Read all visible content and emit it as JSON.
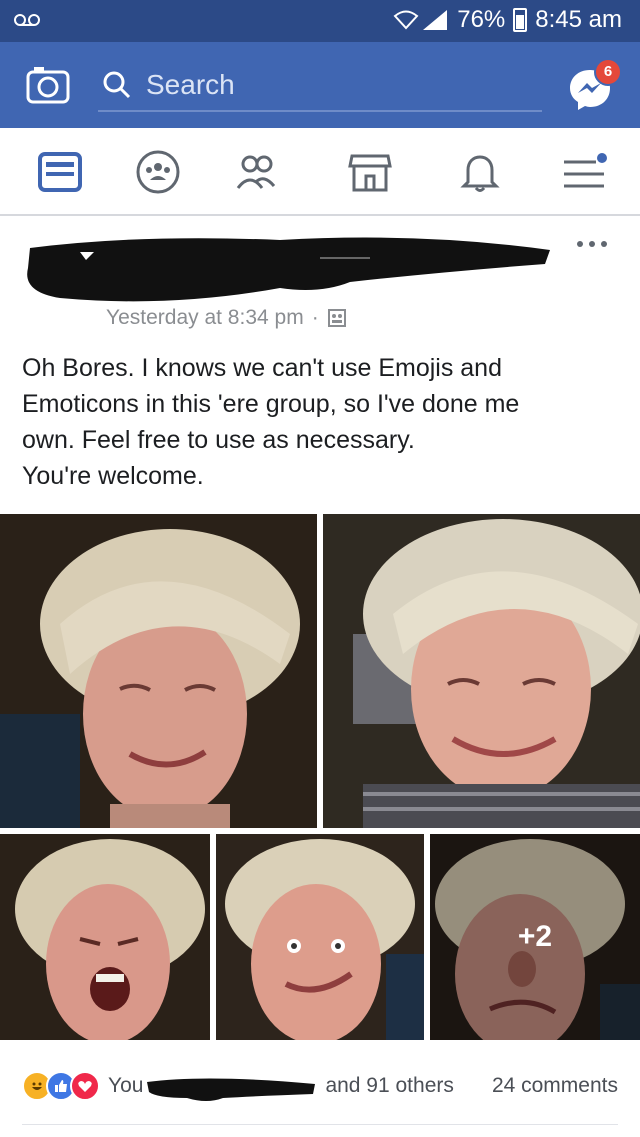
{
  "status_bar": {
    "battery": "76%",
    "time": "8:45 am"
  },
  "header": {
    "search_placeholder": "Search",
    "messenger_badge": "6"
  },
  "nav": {
    "items": [
      "news-feed-icon",
      "groups-icon",
      "friends-icon",
      "marketplace-icon",
      "notifications-icon",
      "menu-icon"
    ],
    "active": "news-feed-icon"
  },
  "post": {
    "timestamp": "Yesterday at 8:34 pm",
    "separator": "·",
    "text_lines": [
      "Oh Bores. I knows we can't use Emojis and",
      "Emoticons in this 'ere group, so I've done me",
      "own. Feel free to use as necessary.",
      "You're welcome."
    ],
    "extra_photos": "+2",
    "reactions": {
      "prefix": "You",
      "suffix": "and 91 others"
    },
    "comments": "24 comments"
  },
  "colors": {
    "status_bar": "#2c4a87",
    "app_bar": "#4066b2",
    "active_tab": "#4066b2",
    "badge": "#e4483a"
  }
}
